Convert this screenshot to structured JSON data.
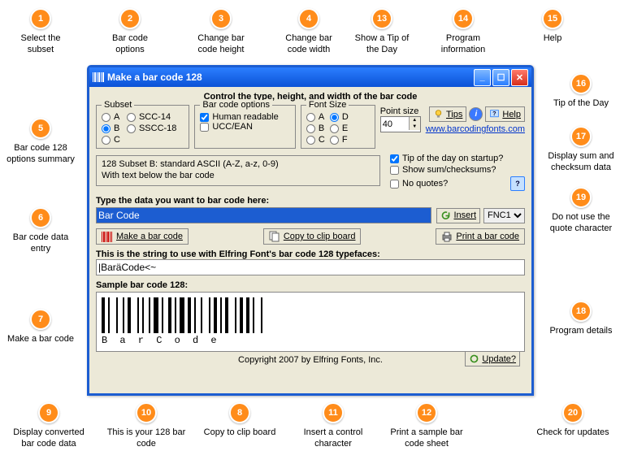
{
  "callouts": {
    "1": "Select the subset",
    "2": "Bar code options",
    "3": "Change bar code height",
    "4": "Change bar code width",
    "5": "Bar code 128 options summary",
    "6": "Bar code data entry",
    "7": "Make a bar code",
    "8": "Copy to clip board",
    "9": "Display converted bar code data",
    "10": "This is your 128 bar code",
    "11": "Insert a control character",
    "12": "Print a sample bar code sheet",
    "13": "Show a Tip of the Day",
    "14": "Program information",
    "15": "Help",
    "16": "Tip of the Day",
    "17": "Display sum and checksum data",
    "18": "Program details",
    "19": "Do not use the quote character",
    "20": "Check for updates"
  },
  "window": {
    "title": "Make a bar code 128",
    "section_title": "Control the type, height, and width of the bar code"
  },
  "subset": {
    "legend": "Subset",
    "a": "A",
    "b": "B",
    "c": "C",
    "scc14": "SCC-14",
    "sscc18": "SSCC-18"
  },
  "options": {
    "legend": "Bar code options",
    "human": "Human readable",
    "ucc": "UCC/EAN"
  },
  "fontsize": {
    "legend": "Font Size",
    "a": "A",
    "b": "B",
    "c": "C",
    "d": "D",
    "e": "E",
    "f": "F"
  },
  "pointsize": {
    "label": "Point size",
    "value": "40"
  },
  "buttons": {
    "tips": "Tips",
    "help": "Help",
    "make": "Make a bar code",
    "copy": "Copy to clip board",
    "insert": "Insert",
    "print": "Print a bar code",
    "update": "Update?"
  },
  "link": "www.barcodingfonts.com",
  "checks": {
    "tip": "Tip of the day on startup?",
    "sum": "Show sum/checksums?",
    "quotes": "No quotes?"
  },
  "summary": {
    "line1": "128 Subset B:  standard ASCII (A-Z, a-z, 0-9)",
    "line2": "With text below the bar code"
  },
  "labels": {
    "data_entry": "Type the data you want to bar code here:",
    "string_label": "This is the string to use with Elfring Font's bar code 128 typefaces:",
    "sample": "Sample bar code 128:"
  },
  "fields": {
    "data": "Bar Code",
    "string": "|BaräCode<~",
    "fnc_select": "FNC1",
    "barcode_text": "B a r    C o d e"
  },
  "copyright": "Copyright 2007 by Elfring Fonts, Inc."
}
